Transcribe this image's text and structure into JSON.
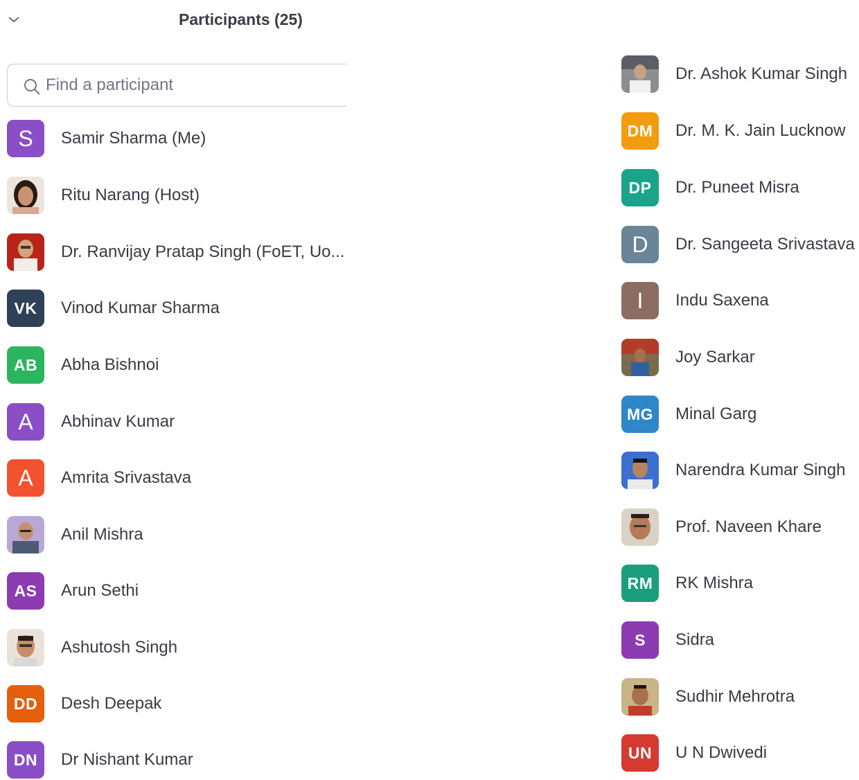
{
  "header": {
    "title": "Participants (25)",
    "collapse_icon": "chevron-down-icon"
  },
  "search": {
    "placeholder": "Find a participant",
    "value": "",
    "icon": "search-icon"
  },
  "participants_left": [
    {
      "name": "Samir Sharma (Me)",
      "initials": "S",
      "color": "#8a4fc7",
      "kind": "letter"
    },
    {
      "name": "Ritu Narang (Host)",
      "initials": "",
      "kind": "photo"
    },
    {
      "name": "Dr. Ranvijay Pratap Singh (FoET, Uo...",
      "initials": "",
      "kind": "photo"
    },
    {
      "name": "Vinod Kumar Sharma",
      "initials": "VK",
      "color": "#2e4157",
      "kind": "letter"
    },
    {
      "name": "Abha Bishnoi",
      "initials": "AB",
      "color": "#2ab55e",
      "kind": "letter"
    },
    {
      "name": "Abhinav Kumar",
      "initials": "A",
      "color": "#8a4fc7",
      "kind": "letter"
    },
    {
      "name": "Amrita Srivastava",
      "initials": "A",
      "color": "#f2522f",
      "kind": "letter"
    },
    {
      "name": "Anil Mishra",
      "initials": "",
      "kind": "photo"
    },
    {
      "name": "Arun Sethi",
      "initials": "AS",
      "color": "#8d3bb0",
      "kind": "letter"
    },
    {
      "name": "Ashutosh Singh",
      "initials": "",
      "kind": "photo"
    },
    {
      "name": "Desh Deepak",
      "initials": "DD",
      "color": "#e4600d",
      "kind": "letter"
    },
    {
      "name": "Dr Nishant Kumar",
      "initials": "DN",
      "color": "#8a4fc7",
      "kind": "letter"
    }
  ],
  "participants_right": [
    {
      "name": "Dr. Ashok Kumar Singh",
      "initials": "",
      "kind": "photo"
    },
    {
      "name": "Dr. M. K. Jain Lucknow",
      "initials": "DM",
      "color": "#f29d10",
      "kind": "letter"
    },
    {
      "name": "Dr. Puneet Misra",
      "initials": "DP",
      "color": "#1ba48a",
      "kind": "letter"
    },
    {
      "name": "Dr. Sangeeta Srivastava",
      "initials": "D",
      "color": "#6a8598",
      "kind": "letter"
    },
    {
      "name": "Indu Saxena",
      "initials": "I",
      "color": "#8d6d63",
      "kind": "letter"
    },
    {
      "name": "Joy Sarkar",
      "initials": "",
      "kind": "photo"
    },
    {
      "name": "Minal Garg",
      "initials": "MG",
      "color": "#2f86c9",
      "kind": "letter"
    },
    {
      "name": "Narendra Kumar Singh",
      "initials": "",
      "kind": "photo"
    },
    {
      "name": "Prof. Naveen Khare",
      "initials": "",
      "kind": "photo"
    },
    {
      "name": "RK Mishra",
      "initials": "RM",
      "color": "#1b9e7c",
      "kind": "letter"
    },
    {
      "name": "Sidra",
      "initials": "S",
      "color": "#8d3bb0",
      "kind": "letter"
    },
    {
      "name": "Sudhir Mehrotra",
      "initials": "",
      "kind": "photo"
    },
    {
      "name": "U N Dwivedi",
      "initials": "UN",
      "color": "#d43a2f",
      "kind": "letter"
    }
  ]
}
